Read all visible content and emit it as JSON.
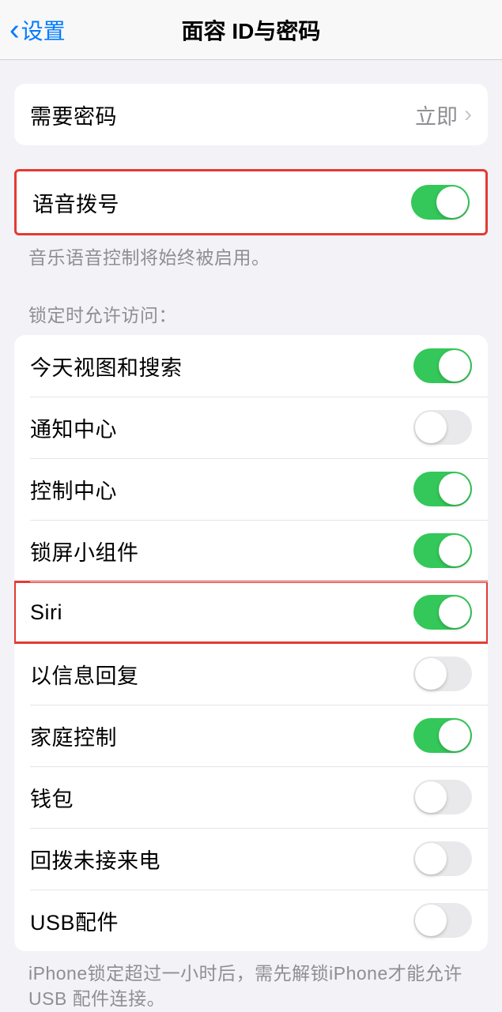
{
  "header": {
    "back_label": "设置",
    "title": "面容 ID与密码"
  },
  "passcode_row": {
    "label": "需要密码",
    "value": "立即"
  },
  "voice_dial": {
    "label": "语音拨号",
    "on": true,
    "footer": "音乐语音控制将始终被启用。"
  },
  "lock_access": {
    "header": "锁定时允许访问：",
    "items": [
      {
        "label": "今天视图和搜索",
        "on": true
      },
      {
        "label": "通知中心",
        "on": false
      },
      {
        "label": "控制中心",
        "on": true
      },
      {
        "label": "锁屏小组件",
        "on": true
      },
      {
        "label": "Siri",
        "on": true,
        "highlight": true
      },
      {
        "label": "以信息回复",
        "on": false
      },
      {
        "label": "家庭控制",
        "on": true
      },
      {
        "label": "钱包",
        "on": false
      },
      {
        "label": "回拨未接来电",
        "on": false
      },
      {
        "label": "USB配件",
        "on": false
      }
    ],
    "footer": "iPhone锁定超过一小时后，需先解锁iPhone才能允许USB 配件连接。"
  }
}
